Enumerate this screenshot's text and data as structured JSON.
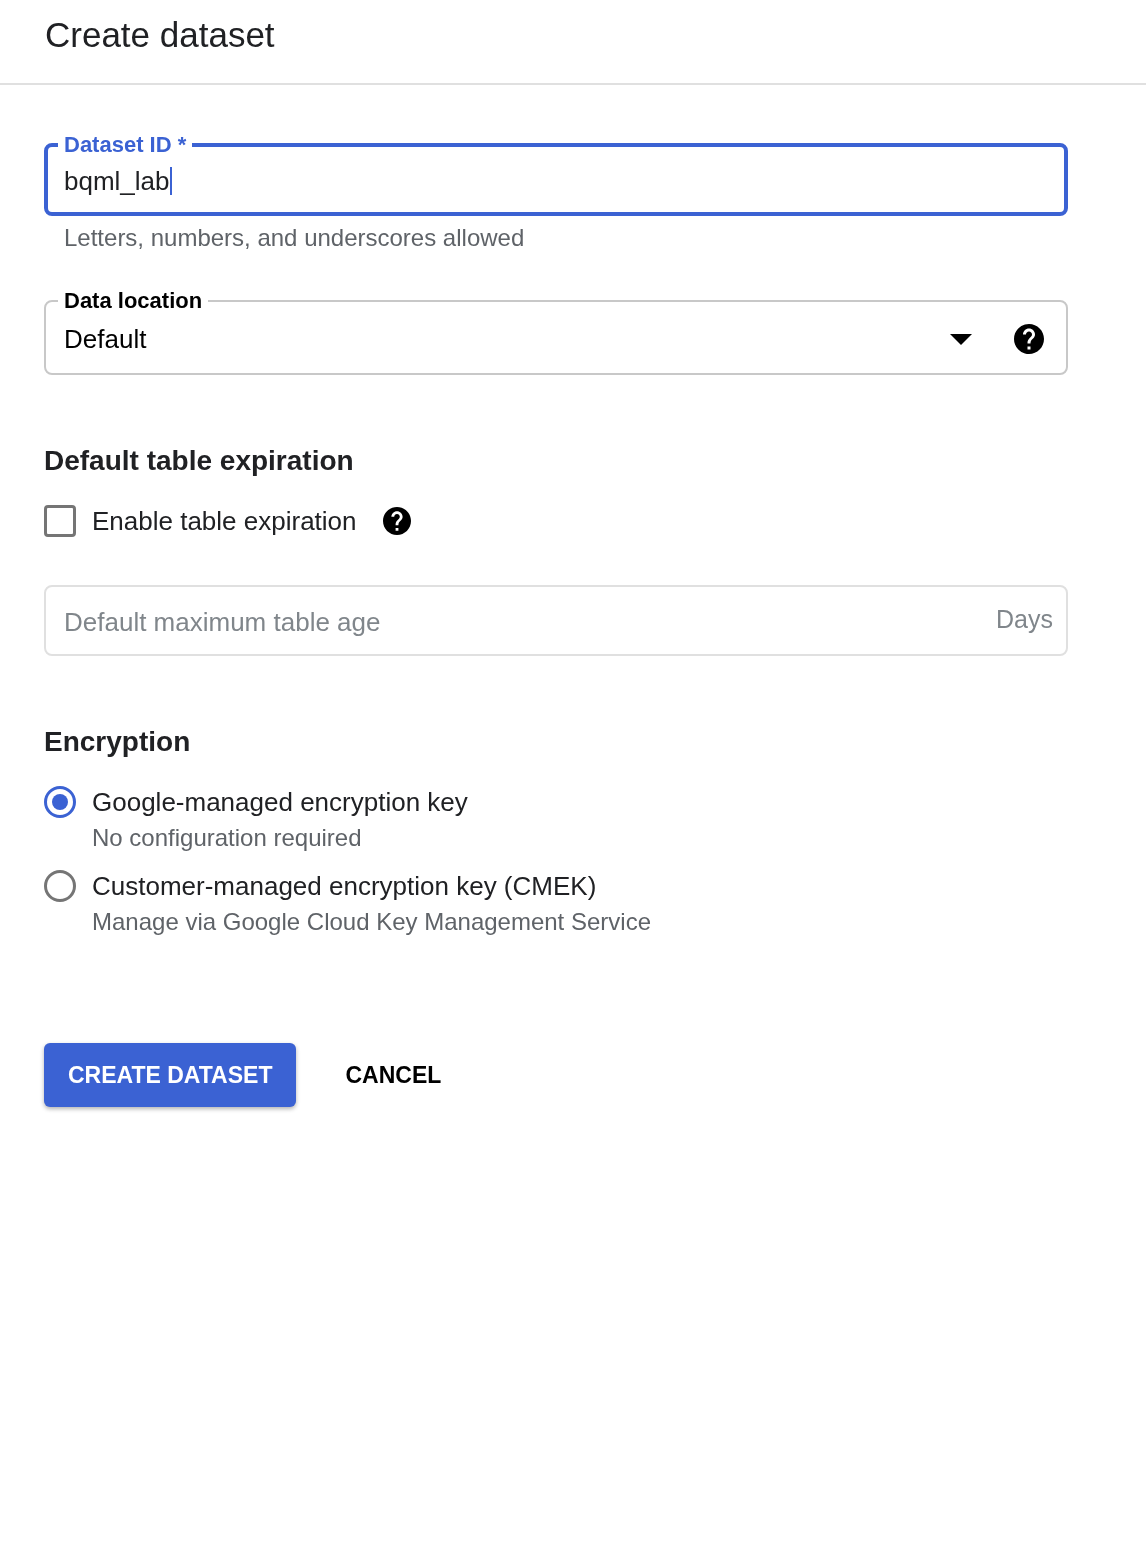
{
  "header": {
    "title": "Create dataset"
  },
  "dataset_id": {
    "label": "Dataset ID *",
    "value": "bqml_lab",
    "focused": true,
    "helper": "Letters, numbers, and underscores allowed"
  },
  "data_location": {
    "label": "Data location",
    "value": "Default"
  },
  "table_expiration": {
    "heading": "Default table expiration",
    "checkbox": {
      "label": "Enable table expiration",
      "checked": false
    },
    "max_age_field": {
      "placeholder": "Default maximum table age",
      "suffix": "Days",
      "disabled": true
    }
  },
  "encryption": {
    "heading": "Encryption",
    "options": [
      {
        "label": "Google-managed encryption key",
        "description": "No configuration required",
        "selected": true
      },
      {
        "label": "Customer-managed encryption key (CMEK)",
        "description": "Manage via Google Cloud Key Management Service",
        "selected": false
      }
    ]
  },
  "buttons": [
    {
      "label": "CREATE DATASET",
      "kind": "primary"
    },
    {
      "label": "CANCEL",
      "kind": "text"
    }
  ]
}
